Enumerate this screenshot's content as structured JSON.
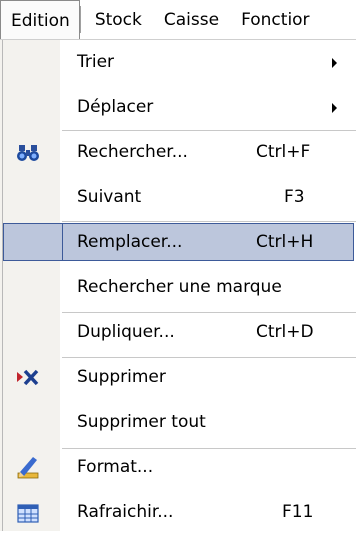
{
  "menubar": {
    "items": [
      {
        "label": "Edition",
        "active": true
      },
      {
        "label": "Stock"
      },
      {
        "label": "Caisse"
      },
      {
        "label": "Fonctior"
      }
    ]
  },
  "menu": {
    "items": [
      {
        "label": "Trier",
        "submenu": true
      },
      {
        "label": "Déplacer",
        "submenu": true
      },
      {
        "label": "Rechercher...",
        "shortcut": "Ctrl+F",
        "icon": "binoculars-icon"
      },
      {
        "label": "Suivant",
        "shortcut": "F3"
      },
      {
        "label": "Remplacer...",
        "shortcut": "Ctrl+H",
        "highlighted": true
      },
      {
        "label": "Rechercher une marque"
      },
      {
        "label": "Dupliquer...",
        "shortcut": "Ctrl+D"
      },
      {
        "label": "Supprimer",
        "icon": "delete-x-icon"
      },
      {
        "label": "Supprimer tout"
      },
      {
        "label": "Format...",
        "icon": "format-pencil-icon"
      },
      {
        "label": "Rafraichir...",
        "shortcut": "F11",
        "icon": "refresh-grid-icon"
      }
    ]
  },
  "colors": {
    "highlight_fill": "#bcc6dc",
    "highlight_border": "#3d5a99",
    "gutter": "#f3f2ee"
  }
}
